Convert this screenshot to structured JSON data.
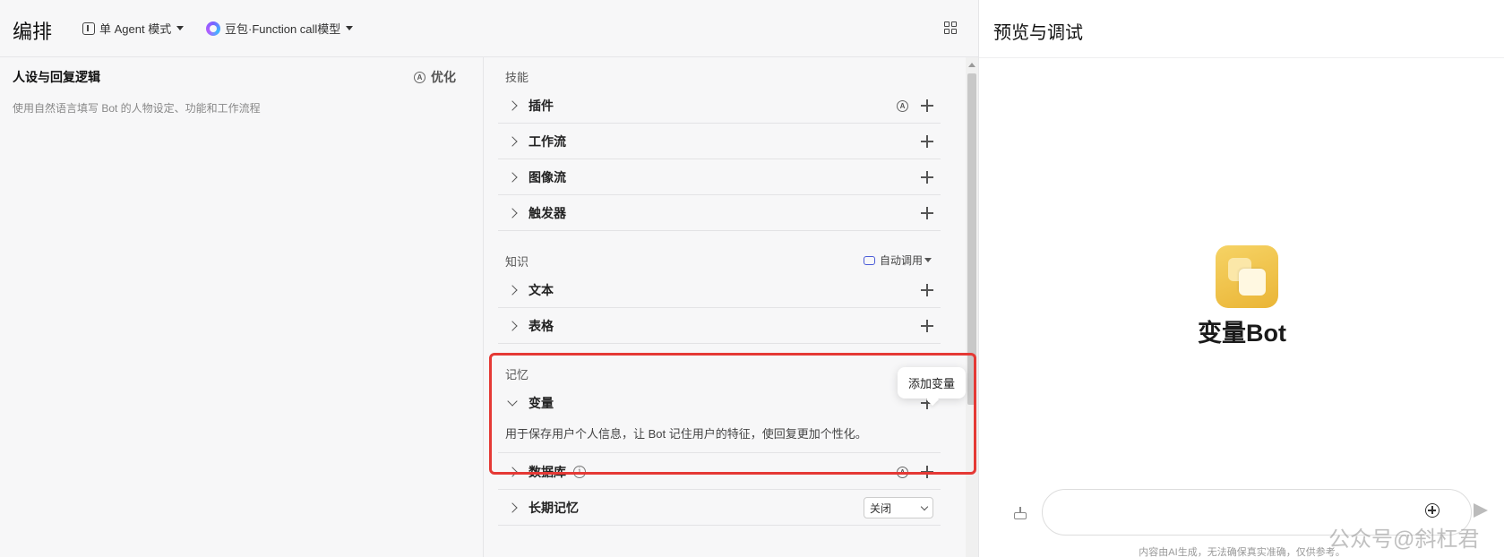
{
  "header": {
    "title": "编排",
    "mode_label": "单 Agent 模式",
    "model_label": "豆包·Function call模型"
  },
  "persona": {
    "title": "人设与回复逻辑",
    "optimize_label": "优化",
    "ai_badge": "A",
    "placeholder": "使用自然语言填写 Bot 的人物设定、功能和工作流程"
  },
  "skills": {
    "label": "技能",
    "items": [
      {
        "label": "插件",
        "has_ai_badge": true
      },
      {
        "label": "工作流"
      },
      {
        "label": "图像流"
      },
      {
        "label": "触发器"
      }
    ]
  },
  "knowledge": {
    "label": "知识",
    "auto_call_label": "自动调用",
    "items": [
      {
        "label": "文本"
      },
      {
        "label": "表格"
      }
    ]
  },
  "memory": {
    "label": "记忆",
    "tooltip": "添加变量",
    "variable": {
      "label": "变量",
      "description": "用于保存用户个人信息，让 Bot 记住用户的特征，使回复更加个性化。"
    },
    "items": [
      {
        "label": "数据库",
        "info_icon": "i"
      },
      {
        "label": "长期记忆",
        "select_value": "关闭"
      }
    ]
  },
  "preview": {
    "title": "预览与调试",
    "bot_name": "变量Bot",
    "disclaimer": "内容由AI生成，无法确保真实准确，仅供参考。",
    "watermark": "公众号@斜杠君"
  },
  "colors": {
    "highlight": "#e53935",
    "avatar_gradient": [
      "#f6d365",
      "#eab536"
    ],
    "auto_call_icon": "#4a5bd8"
  }
}
